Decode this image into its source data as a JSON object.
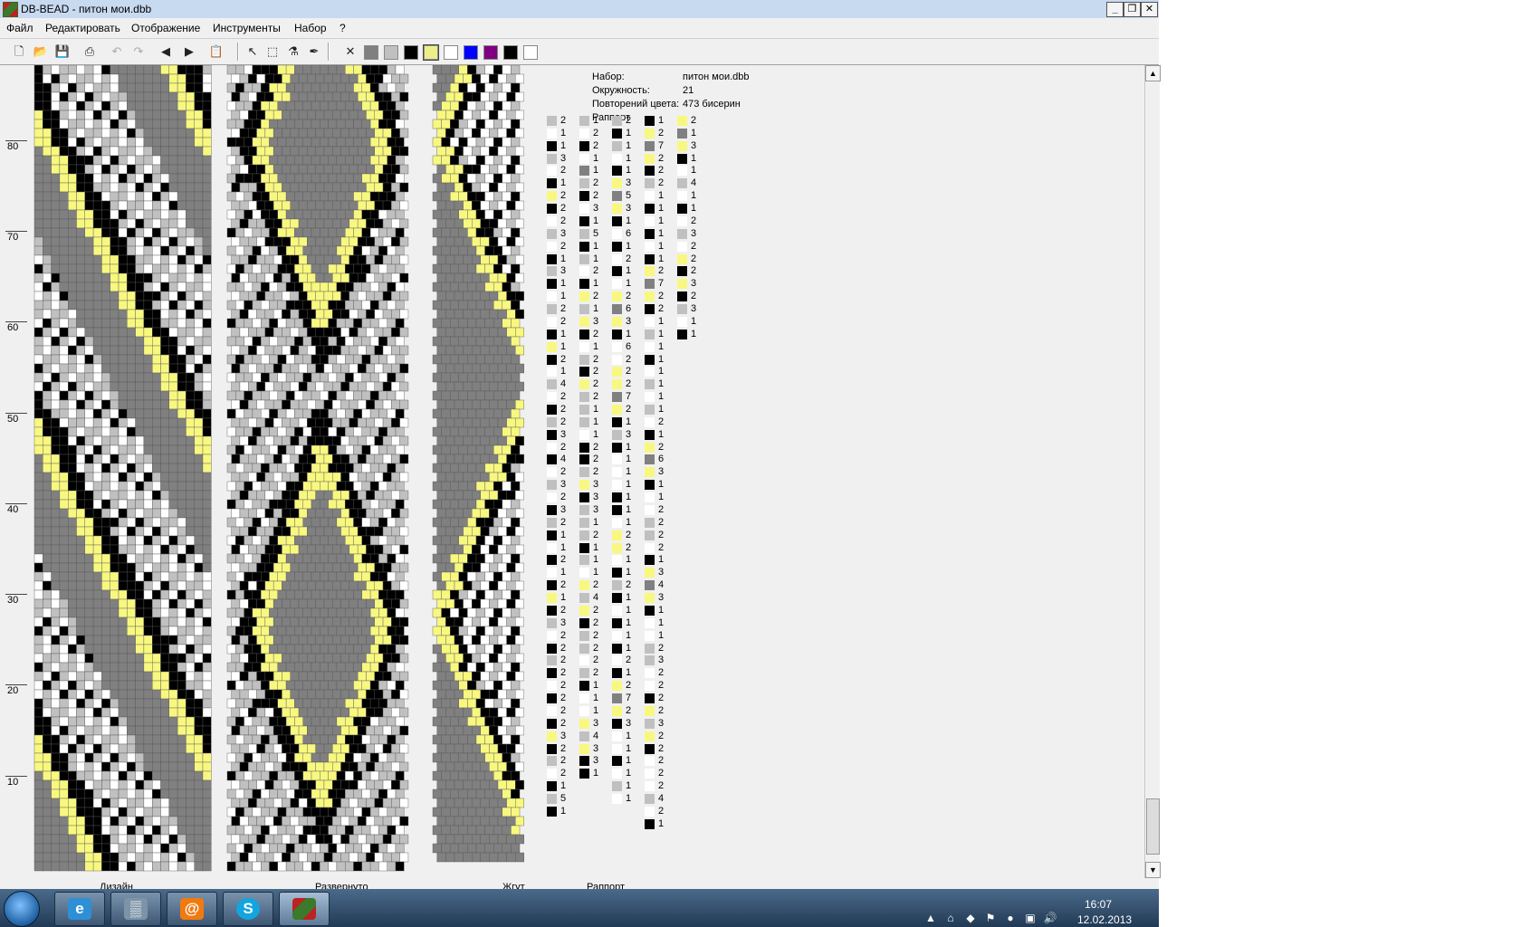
{
  "window": {
    "title": "DB-BEAD - питон мои.dbb"
  },
  "menu": [
    "Файл",
    "Редактировать",
    "Отображение",
    "Инструменты",
    "Набор",
    "?"
  ],
  "toolbar": {
    "palette": [
      "#808080",
      "#c0c0c0",
      "#000000",
      "#eeee88",
      "#ffffff",
      "#0000ff",
      "#800080",
      "#000000",
      "#ffffff"
    ],
    "selected_color": "#eeee88"
  },
  "pattern": {
    "colors": {
      "white": "#ffffff",
      "light_gray": "#c0c0c0",
      "dark_gray": "#808080",
      "black": "#000000",
      "yellow": "#f8f880"
    },
    "row_labels": [
      "80",
      "70",
      "60",
      "50",
      "40",
      "30",
      "20",
      "10"
    ],
    "views": [
      "Дизайн",
      "Развернуто",
      "Жгут",
      "Раппорт"
    ]
  },
  "info": {
    "set_label": "Набор:",
    "set_value": "питон мои.dbb",
    "circ_label": "Окружность:",
    "circ_value": "21",
    "repeat_label": "Повторений цвета:",
    "repeat_value": "473 бисерин",
    "rapport_label": "Раппорт"
  },
  "rapport": [
    [
      [
        "lg",
        2
      ],
      [
        "w",
        1
      ],
      [
        "b",
        1
      ],
      [
        "lg",
        3
      ],
      [
        "w",
        2
      ],
      [
        "b",
        1
      ],
      [
        "y",
        2
      ],
      [
        "b",
        2
      ],
      [
        "w",
        2
      ],
      [
        "lg",
        3
      ],
      [
        "w",
        2
      ],
      [
        "b",
        1
      ],
      [
        "lg",
        3
      ],
      [
        "b",
        1
      ],
      [
        "w",
        1
      ],
      [
        "lg",
        2
      ],
      [
        "w",
        2
      ],
      [
        "b",
        1
      ],
      [
        "y",
        1
      ],
      [
        "b",
        2
      ],
      [
        "w",
        1
      ],
      [
        "lg",
        4
      ],
      [
        "w",
        2
      ],
      [
        "b",
        2
      ],
      [
        "lg",
        2
      ],
      [
        "b",
        3
      ],
      [
        "w",
        2
      ],
      [
        "b",
        4
      ],
      [
        "w",
        2
      ],
      [
        "lg",
        3
      ],
      [
        "w",
        2
      ],
      [
        "b",
        3
      ],
      [
        "lg",
        2
      ],
      [
        "b",
        1
      ],
      [
        "w",
        1
      ],
      [
        "b",
        2
      ],
      [
        "w",
        1
      ],
      [
        "b",
        2
      ],
      [
        "y",
        1
      ],
      [
        "b",
        2
      ],
      [
        "lg",
        3
      ],
      [
        "w",
        2
      ],
      [
        "b",
        2
      ],
      [
        "lg",
        2
      ],
      [
        "b",
        2
      ],
      [
        "w",
        2
      ],
      [
        "b",
        2
      ],
      [
        "w",
        2
      ],
      [
        "b",
        2
      ],
      [
        "y",
        3
      ],
      [
        "b",
        2
      ],
      [
        "lg",
        2
      ],
      [
        "w",
        2
      ],
      [
        "b",
        1
      ],
      [
        "lg",
        5
      ],
      [
        "b",
        1
      ]
    ],
    [
      [
        "lg",
        1
      ],
      [
        "w",
        2
      ],
      [
        "b",
        2
      ],
      [
        "w",
        1
      ],
      [
        "dg",
        1
      ],
      [
        "lg",
        2
      ],
      [
        "b",
        2
      ],
      [
        "w",
        3
      ],
      [
        "b",
        1
      ],
      [
        "lg",
        5
      ],
      [
        "b",
        1
      ],
      [
        "lg",
        1
      ],
      [
        "w",
        2
      ],
      [
        "b",
        1
      ],
      [
        "y",
        2
      ],
      [
        "lg",
        1
      ],
      [
        "y",
        3
      ],
      [
        "b",
        2
      ],
      [
        "w",
        1
      ],
      [
        "lg",
        2
      ],
      [
        "b",
        2
      ],
      [
        "y",
        2
      ],
      [
        "lg",
        2
      ],
      [
        "lg",
        1
      ],
      [
        "lg",
        1
      ],
      [
        "w",
        1
      ],
      [
        "b",
        2
      ],
      [
        "b",
        2
      ],
      [
        "lg",
        2
      ],
      [
        "y",
        3
      ],
      [
        "b",
        3
      ],
      [
        "lg",
        3
      ],
      [
        "lg",
        1
      ],
      [
        "lg",
        2
      ],
      [
        "b",
        1
      ],
      [
        "lg",
        1
      ],
      [
        "w",
        1
      ],
      [
        "y",
        2
      ],
      [
        "lg",
        4
      ],
      [
        "y",
        2
      ],
      [
        "b",
        2
      ],
      [
        "lg",
        2
      ],
      [
        "lg",
        2
      ],
      [
        "w",
        2
      ],
      [
        "lg",
        2
      ],
      [
        "b",
        1
      ],
      [
        "w",
        1
      ],
      [
        "w",
        1
      ],
      [
        "y",
        3
      ],
      [
        "lg",
        4
      ],
      [
        "y",
        3
      ],
      [
        "b",
        3
      ],
      [
        "b",
        1
      ]
    ],
    [
      [
        "lg",
        2
      ],
      [
        "b",
        1
      ],
      [
        "lg",
        1
      ],
      [
        "w",
        1
      ],
      [
        "b",
        1
      ],
      [
        "y",
        3
      ],
      [
        "dg",
        5
      ],
      [
        "y",
        3
      ],
      [
        "b",
        1
      ],
      [
        "w",
        6
      ],
      [
        "b",
        1
      ],
      [
        "w",
        2
      ],
      [
        "b",
        1
      ],
      [
        "w",
        1
      ],
      [
        "y",
        2
      ],
      [
        "dg",
        6
      ],
      [
        "y",
        3
      ],
      [
        "b",
        1
      ],
      [
        "w",
        6
      ],
      [
        "w",
        2
      ],
      [
        "y",
        2
      ],
      [
        "y",
        2
      ],
      [
        "dg",
        7
      ],
      [
        "y",
        2
      ],
      [
        "b",
        1
      ],
      [
        "lg",
        3
      ],
      [
        "b",
        1
      ],
      [
        "w",
        1
      ],
      [
        "w",
        1
      ],
      [
        "w",
        1
      ],
      [
        "b",
        1
      ],
      [
        "b",
        1
      ],
      [
        "w",
        1
      ],
      [
        "y",
        2
      ],
      [
        "y",
        2
      ],
      [
        "w",
        1
      ],
      [
        "b",
        1
      ],
      [
        "lg",
        2
      ],
      [
        "b",
        1
      ],
      [
        "w",
        1
      ],
      [
        "b",
        1
      ],
      [
        "w",
        1
      ],
      [
        "b",
        1
      ],
      [
        "w",
        2
      ],
      [
        "b",
        1
      ],
      [
        "y",
        2
      ],
      [
        "dg",
        7
      ],
      [
        "y",
        2
      ],
      [
        "b",
        3
      ],
      [
        "w",
        1
      ],
      [
        "w",
        1
      ],
      [
        "b",
        1
      ],
      [
        "w",
        1
      ],
      [
        "lg",
        1
      ],
      [
        "w",
        1
      ]
    ],
    [
      [
        "b",
        1
      ],
      [
        "y",
        2
      ],
      [
        "dg",
        7
      ],
      [
        "y",
        2
      ],
      [
        "b",
        2
      ],
      [
        "lg",
        2
      ],
      [
        "w",
        1
      ],
      [
        "b",
        1
      ],
      [
        "w",
        1
      ],
      [
        "b",
        1
      ],
      [
        "w",
        1
      ],
      [
        "b",
        1
      ],
      [
        "y",
        2
      ],
      [
        "dg",
        7
      ],
      [
        "y",
        2
      ],
      [
        "b",
        2
      ],
      [
        "w",
        1
      ],
      [
        "lg",
        1
      ],
      [
        "w",
        1
      ],
      [
        "b",
        1
      ],
      [
        "w",
        1
      ],
      [
        "lg",
        1
      ],
      [
        "w",
        1
      ],
      [
        "lg",
        1
      ],
      [
        "w",
        2
      ],
      [
        "b",
        1
      ],
      [
        "y",
        2
      ],
      [
        "dg",
        6
      ],
      [
        "y",
        3
      ],
      [
        "b",
        1
      ],
      [
        "w",
        1
      ],
      [
        "w",
        2
      ],
      [
        "lg",
        2
      ],
      [
        "lg",
        2
      ],
      [
        "w",
        2
      ],
      [
        "b",
        1
      ],
      [
        "y",
        3
      ],
      [
        "dg",
        4
      ],
      [
        "y",
        3
      ],
      [
        "b",
        1
      ],
      [
        "w",
        1
      ],
      [
        "w",
        1
      ],
      [
        "lg",
        2
      ],
      [
        "lg",
        3
      ],
      [
        "w",
        2
      ],
      [
        "w",
        2
      ],
      [
        "b",
        2
      ],
      [
        "y",
        2
      ],
      [
        "lg",
        3
      ],
      [
        "y",
        2
      ],
      [
        "b",
        2
      ],
      [
        "w",
        2
      ],
      [
        "w",
        2
      ],
      [
        "w",
        2
      ],
      [
        "lg",
        4
      ],
      [
        "w",
        2
      ],
      [
        "b",
        1
      ]
    ],
    [
      [
        "y",
        2
      ],
      [
        "dg",
        1
      ],
      [
        "y",
        3
      ],
      [
        "b",
        1
      ],
      [
        "w",
        1
      ],
      [
        "lg",
        4
      ],
      [
        "w",
        1
      ],
      [
        "b",
        1
      ],
      [
        "w",
        2
      ],
      [
        "lg",
        3
      ],
      [
        "w",
        2
      ],
      [
        "y",
        2
      ],
      [
        "b",
        2
      ],
      [
        "y",
        3
      ],
      [
        "b",
        2
      ],
      [
        "lg",
        3
      ],
      [
        "w",
        1
      ],
      [
        "b",
        1
      ]
    ]
  ],
  "scrollbar": {
    "up": "▲",
    "down": "▼"
  },
  "taskbar": {
    "time": "16:07",
    "date": "12.02.2013"
  }
}
